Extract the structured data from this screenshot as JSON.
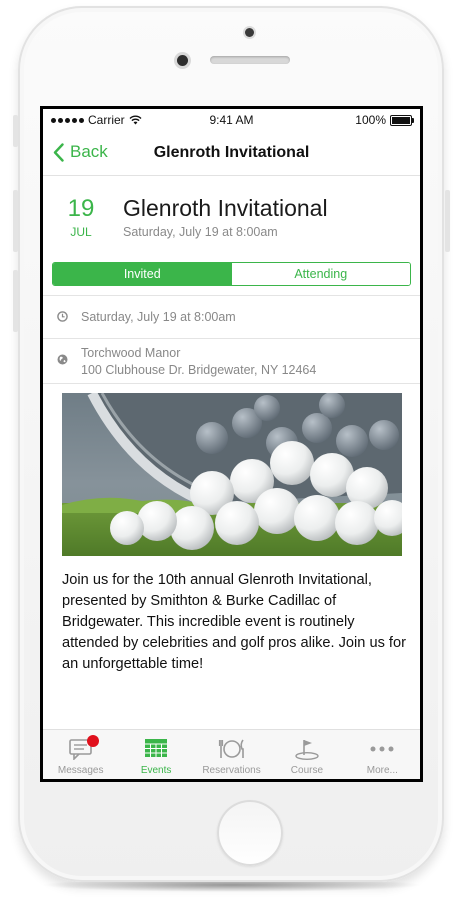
{
  "status_bar": {
    "carrier": "Carrier",
    "time": "9:41 AM",
    "battery": "100%"
  },
  "nav": {
    "back_label": "Back",
    "title": "Glenroth Invitational"
  },
  "event": {
    "day": "19",
    "month": "JUL",
    "title": "Glenroth Invitational",
    "subtitle": "Saturday, July 19 at 8:00am"
  },
  "segments": [
    {
      "label": "Invited",
      "active": true
    },
    {
      "label": "Attending",
      "active": false
    }
  ],
  "details": {
    "datetime": "Saturday, July 19 at 8:00am",
    "location_name": "Torchwood Manor",
    "location_address": "100 Clubhouse Dr. Bridgewater, NY 12464"
  },
  "description": "Join us for the 10th annual Glenroth Invitational, presented by Smithton & Burke Cadillac of Bridgewater. This incredible event is routinely attended by celebrities and golf pros alike. Join us for an unforgettable time!",
  "tabs": [
    {
      "label": "Messages",
      "icon": "messages-icon",
      "badge": true
    },
    {
      "label": "Events",
      "icon": "calendar-icon",
      "active": true
    },
    {
      "label": "Reservations",
      "icon": "reservations-icon"
    },
    {
      "label": "Course",
      "icon": "course-icon"
    },
    {
      "label": "More...",
      "icon": "more-icon"
    }
  ],
  "colors": {
    "accent": "#3bb54a",
    "badge": "#e0101c",
    "text_secondary": "#888888"
  }
}
